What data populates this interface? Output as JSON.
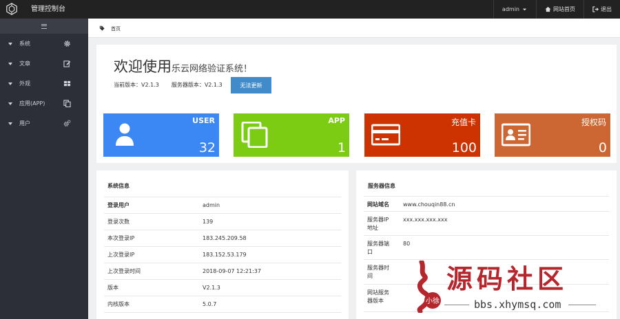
{
  "header": {
    "title": "管理控制台",
    "user_label": "admin",
    "home_label": "网站首页",
    "logout_label": "退出"
  },
  "sidebar": {
    "items": [
      {
        "label": "系统",
        "icon": "gear-icon"
      },
      {
        "label": "文章",
        "icon": "edit-icon"
      },
      {
        "label": "外观",
        "icon": "grid-icon"
      },
      {
        "label": "应用(APP)",
        "icon": "copy-icon"
      },
      {
        "label": "用户",
        "icon": "gears-icon"
      }
    ]
  },
  "breadcrumb": {
    "label": "首页"
  },
  "welcome": {
    "title": "欢迎使用",
    "subtitle": "乐云网络验证系统！",
    "current_version_label": "当前版本：V2.1.3",
    "server_version_label": "服务器版本：V2.1.3",
    "update_button": "无法更新"
  },
  "stats": [
    {
      "label": "USER",
      "value": "32",
      "color": "#3b88f5",
      "icon": "user-icon"
    },
    {
      "label": "APP",
      "value": "1",
      "color": "#7dcc14",
      "icon": "app-copy-icon"
    },
    {
      "label": "充值卡",
      "value": "100",
      "color": "#cc3300",
      "icon": "card-icon"
    },
    {
      "label": "授权码",
      "value": "0",
      "color": "#cc6633",
      "icon": "id-card-icon"
    }
  ],
  "system_info": {
    "title": "系统信息",
    "rows": [
      {
        "key": "登录用户",
        "value": "admin"
      },
      {
        "key": "登录次数",
        "value": "139"
      },
      {
        "key": "本次登录IP",
        "value": "183.245.209.58"
      },
      {
        "key": "上次登录IP",
        "value": "183.152.53.179"
      },
      {
        "key": "上次登录时间",
        "value": "2018-09-07 12:21:37"
      },
      {
        "key": "版本",
        "value": "V2.1.3"
      },
      {
        "key": "内核版本",
        "value": "5.0.7"
      }
    ]
  },
  "server_info": {
    "title": "服务器信息",
    "rows": [
      {
        "key": "网站域名",
        "value": "www.chouqin88.cn"
      },
      {
        "key": "服务器IP地址",
        "value": "xxx.xxx.xxx.xxx"
      },
      {
        "key": "服务器端口",
        "value": "80"
      },
      {
        "key": "服务器时间",
        "value": ""
      },
      {
        "key": "网站服务器版本",
        "value": ""
      }
    ]
  },
  "watermark": {
    "seal_text": "小徐",
    "big_text": "源码社区",
    "url": "bbs.xhymsq.com"
  }
}
